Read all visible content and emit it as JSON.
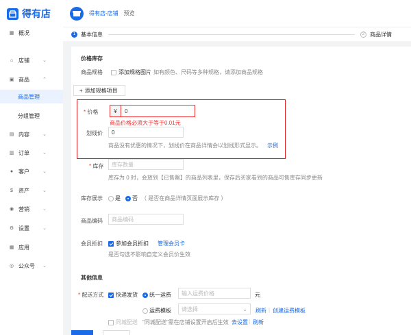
{
  "brand": {
    "name": "得有店",
    "logo_icon": "store-logo-icon",
    "color": "#1a6be8"
  },
  "topbar": {
    "shop_name": "得有店-店铺",
    "preview": "预览"
  },
  "sidebar": {
    "items": [
      {
        "label": "概况",
        "icon": "grid-icon"
      },
      {
        "label": "店铺",
        "icon": "shop-icon"
      },
      {
        "label": "商品",
        "icon": "goods-icon"
      },
      {
        "label": "内容",
        "icon": "content-icon"
      },
      {
        "label": "订单",
        "icon": "order-icon"
      },
      {
        "label": "客户",
        "icon": "customer-icon"
      },
      {
        "label": "资产",
        "icon": "asset-icon"
      },
      {
        "label": "营销",
        "icon": "marketing-icon"
      },
      {
        "label": "设置",
        "icon": "settings-icon"
      },
      {
        "label": "应用",
        "icon": "apps-icon"
      },
      {
        "label": "公众号",
        "icon": "wechat-icon"
      }
    ],
    "sub_items": [
      {
        "label": "商品管理",
        "active": true
      },
      {
        "label": "分组管理",
        "active": false
      }
    ]
  },
  "steps": {
    "step1_num": "1",
    "step1": "基本信息",
    "step2_num": "2",
    "step2": "商品详情"
  },
  "form": {
    "section_price": "价格库存",
    "spec_label": "商品规格",
    "spec_checkbox": "添加规格图片",
    "spec_hint": "如有颜色、尺码等多种规格，请添加商品规格",
    "add_spec_btn": "添加规格项目",
    "price_label": "价格",
    "price_currency": "¥",
    "price_value": "0",
    "price_error": "商品价格必须大于等于0.01元",
    "strike_label": "划线价",
    "strike_value": "0",
    "strike_hint": "商品没有优惠的情况下，划线价在商品详情会以划线形式显示。",
    "strike_link": "示例",
    "stock_label": "库存",
    "stock_placeholder": "库存数量",
    "stock_hint": "库存为 0 时，会放到【已售罄】的商品列表里，保存后买家看到的商品可售库存同步更新",
    "stock_show_label": "库存展示",
    "stock_yes": "是",
    "stock_no": "否",
    "stock_show_hint": "（ 是否在商品详情页面展示库存 ）",
    "code_label": "商品编码",
    "code_placeholder": "商品编码",
    "member_label": "会员折扣",
    "member_checkbox": "参加会员折扣",
    "member_link": "管理会员卡",
    "member_hint": "是否勾选不影响自定义会员价生效",
    "section_other": "其他信息",
    "ship_label": "配送方式",
    "ship_express": "快递发货",
    "ship_unified": "统一运费",
    "ship_fee_placeholder": "输入运费价格",
    "ship_unit": "元",
    "ship_template": "运费模板",
    "ship_template_placeholder": "请选择",
    "refresh": "刷新",
    "create_template": "创建运费模板",
    "city_label": "同城配送",
    "city_hint": "\"同城配送\"需在店铺设置开启后生效",
    "go_set": "去设置",
    "refresh2": "刷新"
  }
}
